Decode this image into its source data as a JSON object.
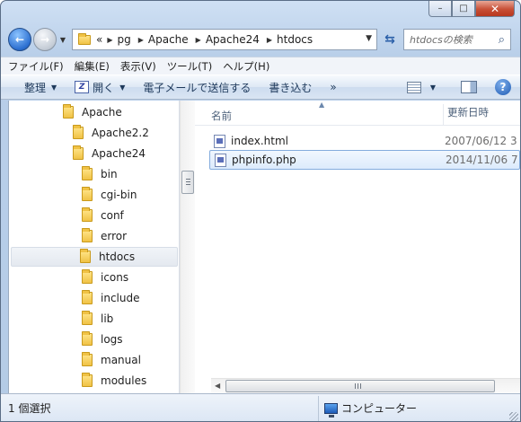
{
  "window": {
    "caption": {
      "minimize": "–",
      "maximize": "□",
      "close": "✕"
    }
  },
  "address": {
    "overflow": "«",
    "crumbs": [
      "pg",
      "Apache",
      "Apache24",
      "htdocs"
    ],
    "search_placeholder": "htdocsの検索"
  },
  "menu": [
    "ファイル(F)",
    "編集(E)",
    "表示(V)",
    "ツール(T)",
    "ヘルプ(H)"
  ],
  "commands": {
    "organize": "整理",
    "open": "開く",
    "email": "電子メールで送信する",
    "burn": "書き込む",
    "more": "»",
    "help": "?"
  },
  "tree": [
    {
      "label": "Apache",
      "level": 0
    },
    {
      "label": "Apache2.2",
      "level": 1
    },
    {
      "label": "Apache24",
      "level": 1
    },
    {
      "label": "bin",
      "level": 2
    },
    {
      "label": "cgi-bin",
      "level": 2
    },
    {
      "label": "conf",
      "level": 2
    },
    {
      "label": "error",
      "level": 2
    },
    {
      "label": "htdocs",
      "level": 2,
      "selected": true
    },
    {
      "label": "icons",
      "level": 2
    },
    {
      "label": "include",
      "level": 2
    },
    {
      "label": "lib",
      "level": 2
    },
    {
      "label": "logs",
      "level": 2
    },
    {
      "label": "manual",
      "level": 2
    },
    {
      "label": "modules",
      "level": 2
    }
  ],
  "columns": {
    "name": "名前",
    "date": "更新日時"
  },
  "files": [
    {
      "name": "index.html",
      "date": "2007/06/12 3"
    },
    {
      "name": "phpinfo.php",
      "date": "2014/11/06 7",
      "selected": true
    }
  ],
  "status": {
    "selection": "1 個選択",
    "location": "コンピューター"
  }
}
